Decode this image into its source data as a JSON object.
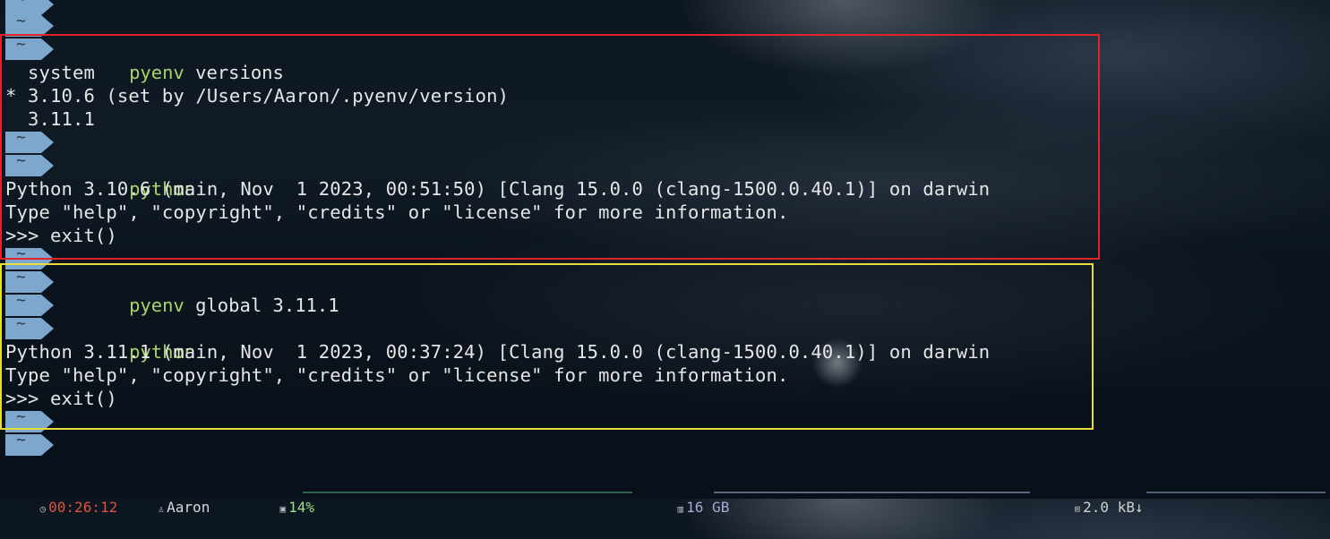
{
  "prompt": {
    "tilde": "~"
  },
  "commands": {
    "pyenv_versions": {
      "kw": "pyenv",
      "args": " versions"
    },
    "python1": {
      "kw": "python",
      "args": ""
    },
    "pyenv_global": {
      "kw": "pyenv",
      "args": " global 3.11.1"
    },
    "python2": {
      "kw": "python",
      "args": ""
    }
  },
  "output": {
    "versions": [
      "  system",
      "* 3.10.6 (set by /Users/Aaron/.pyenv/version)",
      "  3.11.1"
    ],
    "python1": [
      "Python 3.10.6 (main, Nov  1 2023, 00:51:50) [Clang 15.0.0 (clang-1500.0.40.1)] on darwin",
      "Type \"help\", \"copyright\", \"credits\" or \"license\" for more information.",
      ">>> exit()"
    ],
    "python2": [
      "Python 3.11.1 (main, Nov  1 2023, 00:37:24) [Clang 15.0.0 (clang-1500.0.40.1)] on darwin",
      "Type \"help\", \"copyright\", \"credits\" or \"license\" for more information.",
      ">>> exit()"
    ]
  },
  "statusbar": {
    "time": "00:26:12",
    "user": "Aaron",
    "cpu": "14%",
    "memory": "16 GB",
    "network": "2.0 kB↓",
    "colors": {
      "time": "#e0503c",
      "user": "#d8d8d8",
      "cpu": "#9be08a",
      "memory": "#a9a9d6",
      "network": "#d0d0d0"
    }
  },
  "highlights": {
    "red": "#e0242c",
    "yellow": "#e6dc3a"
  }
}
